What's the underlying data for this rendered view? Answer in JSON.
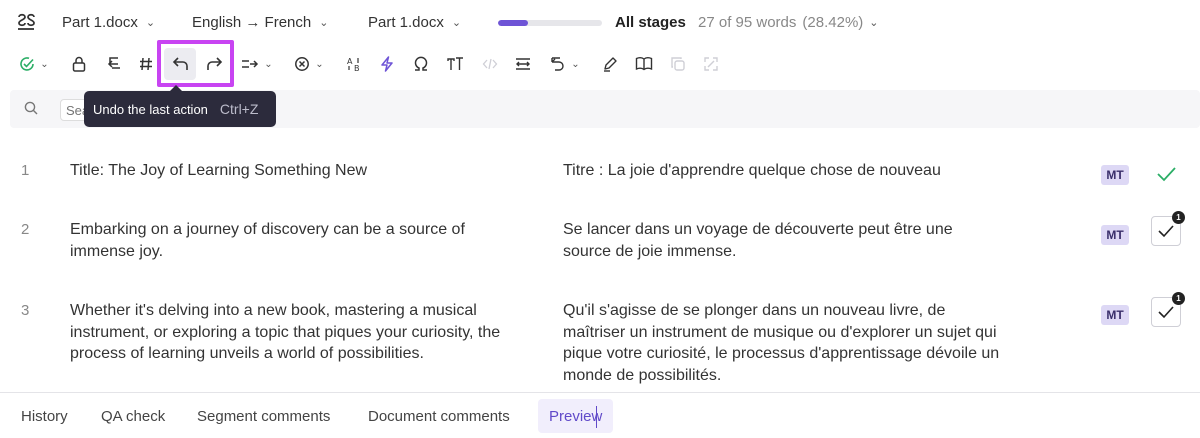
{
  "header": {
    "doc1": "Part 1.docx",
    "language_pair": "English → French",
    "doc2": "Part 1.docx",
    "progress_fraction": 0.2842,
    "stage": "All stages",
    "word_count": "27 of 95 words",
    "word_percent": "(28.42%)",
    "accent_color": "#6e54d6"
  },
  "toolbar": {
    "icons": [
      "confirm-icon",
      "lock-icon",
      "clear-target-icon",
      "hash-icon",
      "undo-icon",
      "redo-icon",
      "copy-source-icon",
      "clear-icon",
      "case-icon",
      "lightning-icon",
      "omega-icon",
      "text-format-icon",
      "tag-icon",
      "join-icon",
      "revert-icon",
      "edit-pen-icon",
      "book-icon",
      "copy-icon",
      "split-icon"
    ],
    "highlight_color": "#c844f2"
  },
  "search": {
    "placeholder": "Sear"
  },
  "tooltip": {
    "label": "Undo the last action",
    "shortcut": "Ctrl+Z"
  },
  "segments": [
    {
      "num": "1",
      "source": "Title: The Joy of Learning Something New",
      "target": "Titre : La joie d'apprendre quelque chose de nouveau",
      "badge": "MT",
      "status": "confirmed"
    },
    {
      "num": "2",
      "source": "Embarking on a journey of discovery can be a source of immense joy.",
      "target": "Se lancer dans un voyage de découverte peut être une source de joie immense.",
      "badge": "MT",
      "status": "pending",
      "notification": "1"
    },
    {
      "num": "3",
      "source": "Whether it's delving into a new book, mastering a musical instrument, or exploring a topic that piques your curiosity, the process of learning unveils a world of possibilities.",
      "target": "Qu'il s'agisse de se plonger dans un nouveau livre, de maîtriser un instrument de musique ou d'explorer un sujet qui pique votre curiosité, le processus d'apprentissage dévoile un monde de possibilités.",
      "badge": "MT",
      "status": "pending",
      "notification": "1"
    }
  ],
  "bottom_tabs": {
    "history": "History",
    "qa": "QA check",
    "segment_comments": "Segment comments",
    "document_comments": "Document comments",
    "preview": "Preview"
  }
}
